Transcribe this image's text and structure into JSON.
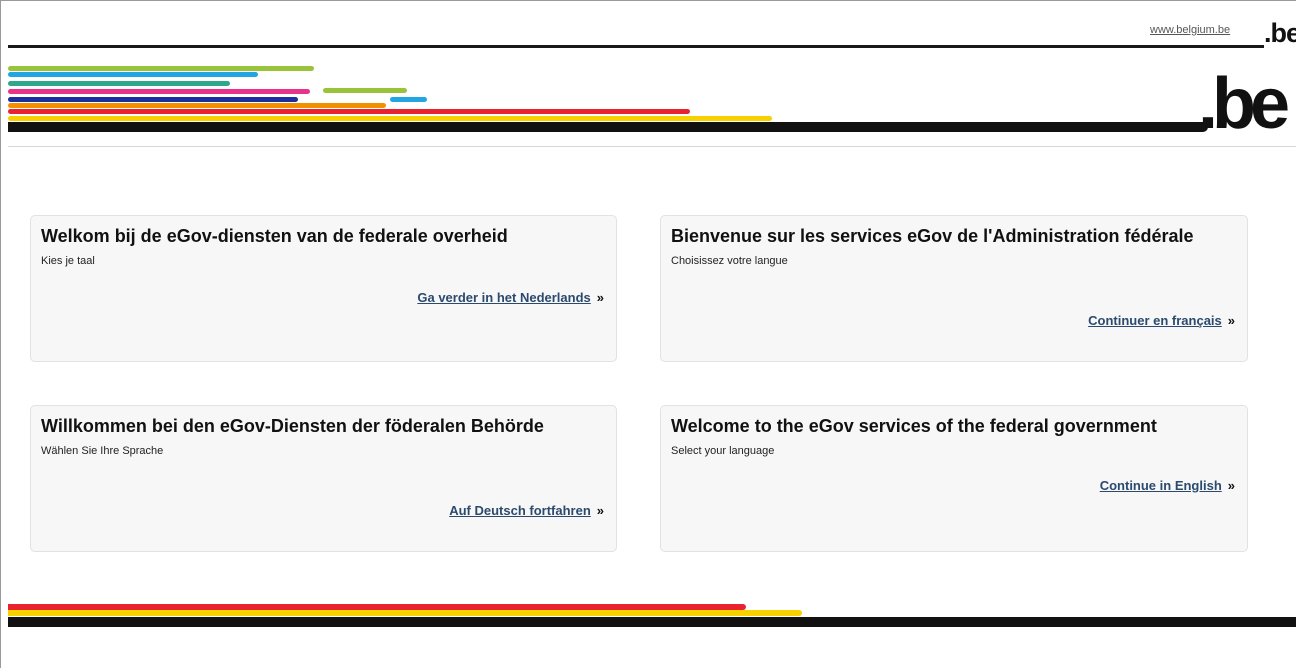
{
  "header": {
    "site_link": "www.belgium.be",
    "logo_text": ".be"
  },
  "colors": {
    "lime": "#9ac33c",
    "cyan": "#21a6e3",
    "teal": "#2ea88b",
    "pink": "#e9338a",
    "blue": "#1b2ea0",
    "orange": "#f29100",
    "red": "#e8232f",
    "yellow": "#f7d000",
    "black": "#111111",
    "link": "#2b4a6e"
  },
  "cards": [
    {
      "title": "Welkom bij de eGov-diensten van de federale overheid",
      "subtitle": "Kies je taal",
      "link": "Ga verder in het Nederlands",
      "arrow": "»"
    },
    {
      "title": "Bienvenue sur les services eGov de l'Administration fédérale",
      "subtitle": "Choisissez votre langue",
      "link": "Continuer en français",
      "arrow": "»"
    },
    {
      "title": "Willkommen bei den eGov-Diensten der föderalen Behörde",
      "subtitle": "Wählen Sie Ihre Sprache",
      "link": "Auf Deutsch fortfahren",
      "arrow": "»"
    },
    {
      "title": "Welcome to the eGov services of the federal government",
      "subtitle": "Select your language",
      "link": "Continue in English",
      "arrow": "»"
    }
  ]
}
